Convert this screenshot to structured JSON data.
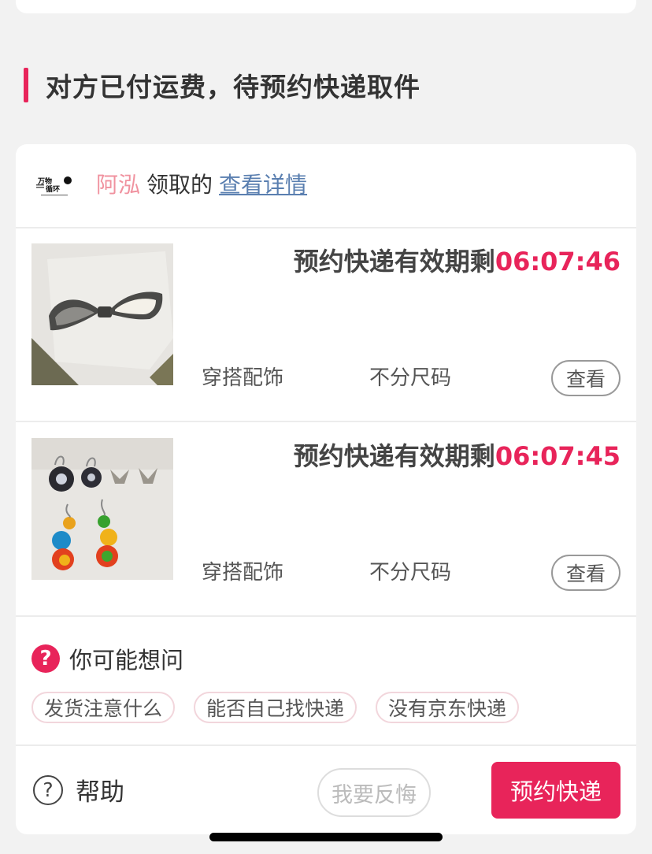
{
  "section": {
    "title": "对方已付运费，待预约快递取件"
  },
  "claimer": {
    "logo_icon": "brand-logo",
    "name": "阿泓",
    "action": "领取的",
    "detail_link": "查看详情"
  },
  "items": [
    {
      "image_icon": "bow-brooch-photo",
      "countdown_label": "预约快递有效期剩",
      "countdown_time": "06:07:46",
      "category": "穿搭配饰",
      "size": "不分尺码",
      "view_label": "查看"
    },
    {
      "image_icon": "earrings-photo",
      "countdown_label": "预约快递有效期剩",
      "countdown_time": "06:07:45",
      "category": "穿搭配饰",
      "size": "不分尺码",
      "view_label": "查看"
    }
  ],
  "faq": {
    "icon": "question-icon",
    "title": "你可能想问",
    "chips": [
      "发货注意什么",
      "能否自己找快递",
      "没有京东快递"
    ]
  },
  "footer": {
    "help_icon": "help-icon",
    "help_label": "帮助",
    "regret_label": "我要反悔",
    "book_label": "预约快递"
  },
  "colors": {
    "accent": "#e8245a",
    "link": "#5a7fb0",
    "name": "#f0929f"
  }
}
